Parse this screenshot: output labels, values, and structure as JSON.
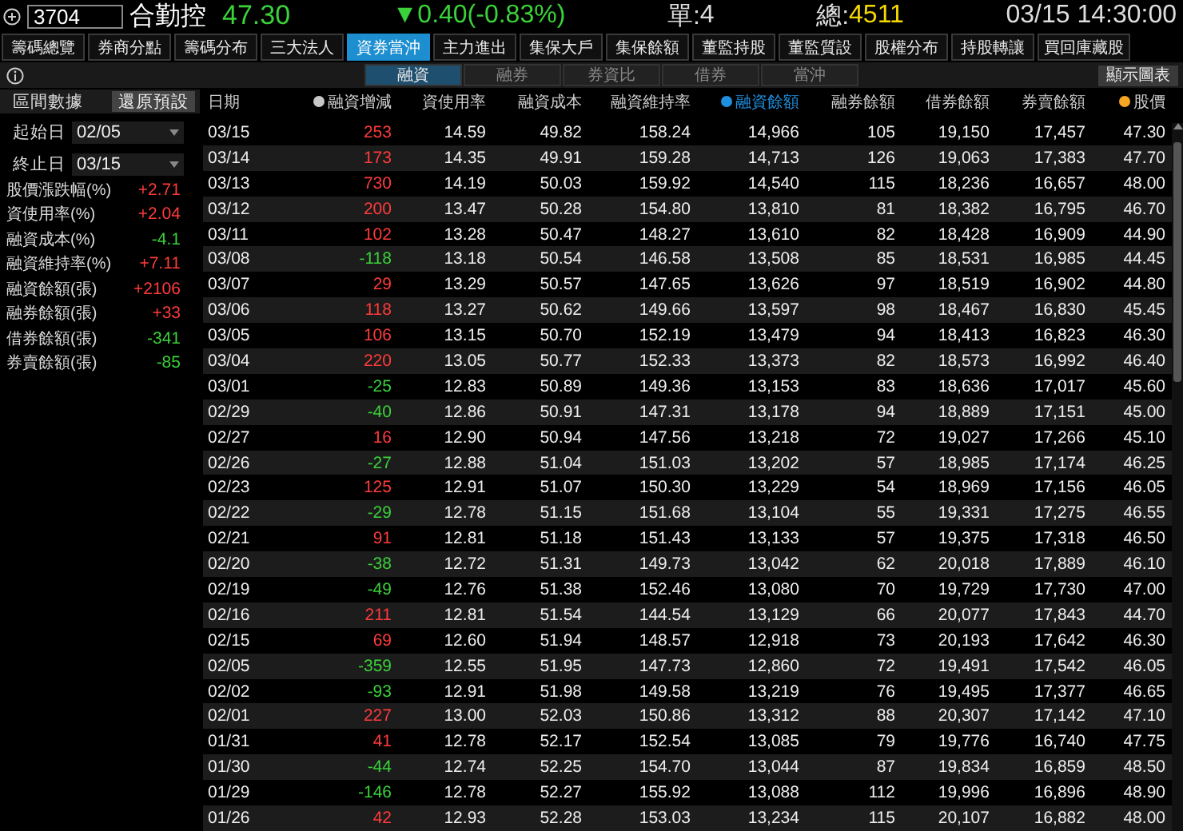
{
  "quote": {
    "code": "3704",
    "name": "合勤控",
    "price": "47.30",
    "change": "▼0.40(-0.83%)",
    "rising": false,
    "volume_label": "單:",
    "volume": "4",
    "total_label": "總:",
    "total": "4511",
    "time": "03/15 14:30:00"
  },
  "tabs": [
    {
      "label": "籌碼總覽",
      "selected": false
    },
    {
      "label": "券商分點",
      "selected": false
    },
    {
      "label": "籌碼分布",
      "selected": false
    },
    {
      "label": "三大法人",
      "selected": false
    },
    {
      "label": "資券當沖",
      "selected": true
    },
    {
      "label": "主力進出",
      "selected": false
    },
    {
      "label": "集保大戶",
      "selected": false
    },
    {
      "label": "集保餘額",
      "selected": false
    },
    {
      "label": "董監持股",
      "selected": false
    },
    {
      "label": "董監質設",
      "selected": false
    },
    {
      "label": "股權分布",
      "selected": false
    },
    {
      "label": "持股轉讓",
      "selected": false
    },
    {
      "label": "買回庫藏股",
      "selected": false
    }
  ],
  "sub_tabs": [
    {
      "label": "融資",
      "selected": true
    },
    {
      "label": "融券",
      "selected": false
    },
    {
      "label": "券資比",
      "selected": false
    },
    {
      "label": "借券",
      "selected": false
    },
    {
      "label": "當沖",
      "selected": false
    }
  ],
  "chart_button": "顯示圖表",
  "sidebar": {
    "title": "區間數據",
    "reset_button": "還原預設",
    "start": {
      "label": "起始日",
      "value": "02/05"
    },
    "end": {
      "label": "終止日",
      "value": "03/15"
    },
    "stats": [
      {
        "label": "股價漲跌幅(%)",
        "value": "+2.71",
        "rising": true
      },
      {
        "label": "資使用率(%)",
        "value": "+2.04",
        "rising": true
      },
      {
        "label": "融資成本(%)",
        "value": "-4.1",
        "rising": false
      },
      {
        "label": "融資維持率(%)",
        "value": "+7.11",
        "rising": true
      },
      {
        "label": "融資餘額(張)",
        "value": "+2106",
        "rising": true
      },
      {
        "label": "融券餘額(張)",
        "value": "+33",
        "rising": true
      },
      {
        "label": "借券餘額(張)",
        "value": "-341",
        "rising": false
      },
      {
        "label": "券賣餘額(張)",
        "value": "-85",
        "rising": false
      }
    ]
  },
  "table": {
    "columns": [
      {
        "label": "日期",
        "highlighted": false
      },
      {
        "label": "融資增減",
        "highlighted": false,
        "color": "#c8c8c8"
      },
      {
        "label": "資使用率",
        "highlighted": false
      },
      {
        "label": "融資成本",
        "highlighted": false
      },
      {
        "label": "融資維持率",
        "highlighted": false
      },
      {
        "label": "融資餘額",
        "highlighted": true,
        "color": "#1e90e0"
      },
      {
        "label": "融券餘額",
        "highlighted": false
      },
      {
        "label": "借券餘額",
        "highlighted": false
      },
      {
        "label": "券賣餘額",
        "highlighted": false
      },
      {
        "label": "股價",
        "highlighted": false,
        "color": "#f5a623"
      }
    ],
    "rows": [
      {
        "rising": true,
        "cells": [
          "03/15",
          "253",
          "14.59",
          "49.82",
          "158.24",
          "14,966",
          "105",
          "19,150",
          "17,457",
          "47.30"
        ]
      },
      {
        "rising": true,
        "cells": [
          "03/14",
          "173",
          "14.35",
          "49.91",
          "159.28",
          "14,713",
          "126",
          "19,063",
          "17,383",
          "47.70"
        ]
      },
      {
        "rising": true,
        "cells": [
          "03/13",
          "730",
          "14.19",
          "50.03",
          "159.92",
          "14,540",
          "115",
          "18,236",
          "16,657",
          "48.00"
        ]
      },
      {
        "rising": true,
        "cells": [
          "03/12",
          "200",
          "13.47",
          "50.28",
          "154.80",
          "13,810",
          "81",
          "18,382",
          "16,795",
          "46.70"
        ]
      },
      {
        "rising": true,
        "cells": [
          "03/11",
          "102",
          "13.28",
          "50.47",
          "148.27",
          "13,610",
          "82",
          "18,428",
          "16,909",
          "44.90"
        ]
      },
      {
        "rising": false,
        "cells": [
          "03/08",
          "-118",
          "13.18",
          "50.54",
          "146.58",
          "13,508",
          "85",
          "18,531",
          "16,985",
          "44.45"
        ]
      },
      {
        "rising": true,
        "cells": [
          "03/07",
          "29",
          "13.29",
          "50.57",
          "147.65",
          "13,626",
          "97",
          "18,519",
          "16,902",
          "44.80"
        ]
      },
      {
        "rising": true,
        "cells": [
          "03/06",
          "118",
          "13.27",
          "50.62",
          "149.66",
          "13,597",
          "98",
          "18,467",
          "16,830",
          "45.45"
        ]
      },
      {
        "rising": true,
        "cells": [
          "03/05",
          "106",
          "13.15",
          "50.70",
          "152.19",
          "13,479",
          "94",
          "18,413",
          "16,823",
          "46.30"
        ]
      },
      {
        "rising": true,
        "cells": [
          "03/04",
          "220",
          "13.05",
          "50.77",
          "152.33",
          "13,373",
          "82",
          "18,573",
          "16,992",
          "46.40"
        ]
      },
      {
        "rising": false,
        "cells": [
          "03/01",
          "-25",
          "12.83",
          "50.89",
          "149.36",
          "13,153",
          "83",
          "18,636",
          "17,017",
          "45.60"
        ]
      },
      {
        "rising": false,
        "cells": [
          "02/29",
          "-40",
          "12.86",
          "50.91",
          "147.31",
          "13,178",
          "94",
          "18,889",
          "17,151",
          "45.00"
        ]
      },
      {
        "rising": true,
        "cells": [
          "02/27",
          "16",
          "12.90",
          "50.94",
          "147.56",
          "13,218",
          "72",
          "19,027",
          "17,266",
          "45.10"
        ]
      },
      {
        "rising": false,
        "cells": [
          "02/26",
          "-27",
          "12.88",
          "51.04",
          "151.03",
          "13,202",
          "57",
          "18,985",
          "17,174",
          "46.25"
        ]
      },
      {
        "rising": true,
        "cells": [
          "02/23",
          "125",
          "12.91",
          "51.07",
          "150.30",
          "13,229",
          "54",
          "18,969",
          "17,156",
          "46.05"
        ]
      },
      {
        "rising": false,
        "cells": [
          "02/22",
          "-29",
          "12.78",
          "51.15",
          "151.68",
          "13,104",
          "55",
          "19,331",
          "17,275",
          "46.55"
        ]
      },
      {
        "rising": true,
        "cells": [
          "02/21",
          "91",
          "12.81",
          "51.18",
          "151.43",
          "13,133",
          "57",
          "19,375",
          "17,318",
          "46.50"
        ]
      },
      {
        "rising": false,
        "cells": [
          "02/20",
          "-38",
          "12.72",
          "51.31",
          "149.73",
          "13,042",
          "62",
          "20,018",
          "17,889",
          "46.10"
        ]
      },
      {
        "rising": false,
        "cells": [
          "02/19",
          "-49",
          "12.76",
          "51.38",
          "152.46",
          "13,080",
          "70",
          "19,729",
          "17,730",
          "47.00"
        ]
      },
      {
        "rising": true,
        "cells": [
          "02/16",
          "211",
          "12.81",
          "51.54",
          "144.54",
          "13,129",
          "66",
          "20,077",
          "17,843",
          "44.70"
        ]
      },
      {
        "rising": true,
        "cells": [
          "02/15",
          "69",
          "12.60",
          "51.94",
          "148.57",
          "12,918",
          "73",
          "20,193",
          "17,642",
          "46.30"
        ]
      },
      {
        "rising": false,
        "cells": [
          "02/05",
          "-359",
          "12.55",
          "51.95",
          "147.73",
          "12,860",
          "72",
          "19,491",
          "17,542",
          "46.05"
        ]
      },
      {
        "rising": false,
        "cells": [
          "02/02",
          "-93",
          "12.91",
          "51.98",
          "149.58",
          "13,219",
          "76",
          "19,495",
          "17,377",
          "46.65"
        ]
      },
      {
        "rising": true,
        "cells": [
          "02/01",
          "227",
          "13.00",
          "52.03",
          "150.86",
          "13,312",
          "88",
          "20,307",
          "17,142",
          "47.10"
        ]
      },
      {
        "rising": true,
        "cells": [
          "01/31",
          "41",
          "12.78",
          "52.17",
          "152.54",
          "13,085",
          "79",
          "19,776",
          "16,740",
          "47.75"
        ]
      },
      {
        "rising": false,
        "cells": [
          "01/30",
          "-44",
          "12.74",
          "52.25",
          "154.70",
          "13,044",
          "87",
          "19,834",
          "16,859",
          "48.50"
        ]
      },
      {
        "rising": false,
        "cells": [
          "01/29",
          "-146",
          "12.78",
          "52.27",
          "155.92",
          "13,088",
          "112",
          "19,996",
          "16,896",
          "48.90"
        ]
      },
      {
        "rising": true,
        "cells": [
          "01/26",
          "42",
          "12.93",
          "52.28",
          "153.03",
          "13,234",
          "115",
          "20,107",
          "16,882",
          "48.00"
        ]
      }
    ]
  }
}
